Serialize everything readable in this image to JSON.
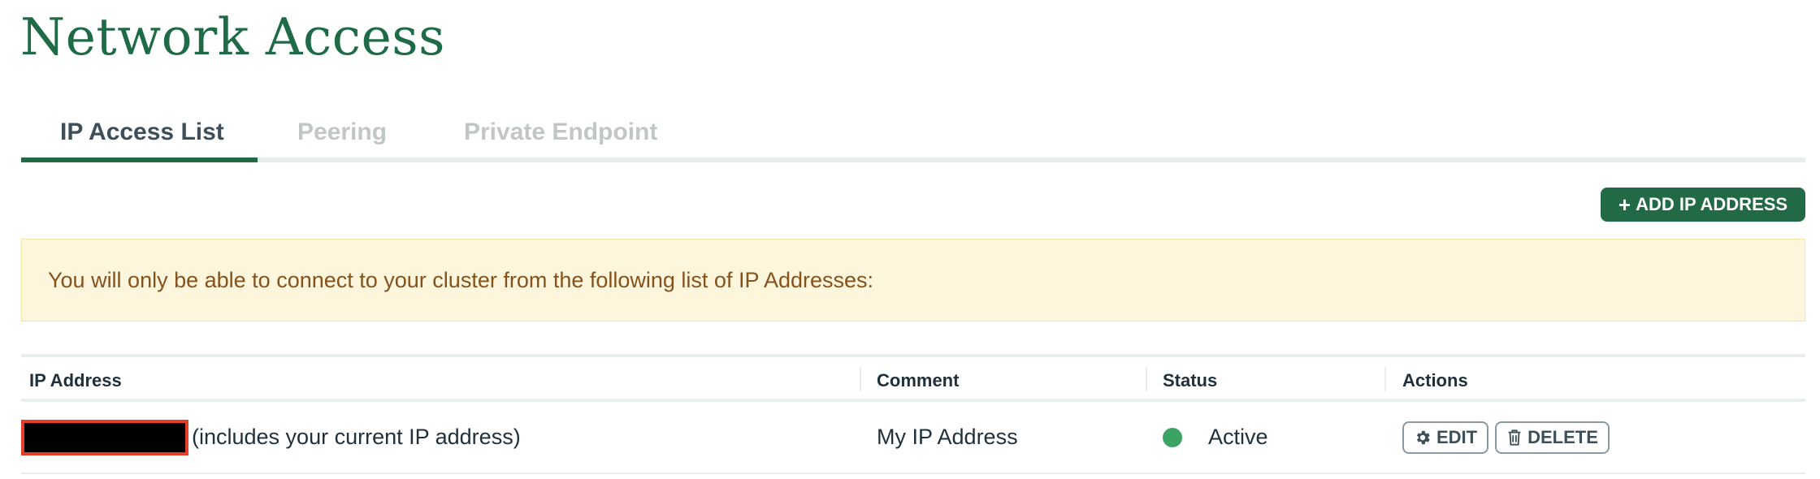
{
  "page": {
    "title": "Network Access"
  },
  "tabs": [
    {
      "label": "IP Access List",
      "active": true
    },
    {
      "label": "Peering",
      "active": false
    },
    {
      "label": "Private Endpoint",
      "active": false
    }
  ],
  "toolbar": {
    "add_label": "ADD IP ADDRESS",
    "add_icon": "plus-icon"
  },
  "banner": {
    "message": "You will only be able to connect to your cluster from the following list of IP Addresses:"
  },
  "table": {
    "headers": {
      "ip": "IP Address",
      "comment": "Comment",
      "status": "Status",
      "actions": "Actions"
    },
    "rows": [
      {
        "ip_note": "(includes your current IP address)",
        "comment": "My IP Address",
        "status": "Active",
        "status_color": "#3ba363",
        "edit_label": "EDIT",
        "edit_icon": "gear-icon",
        "delete_label": "DELETE",
        "delete_icon": "trash-icon"
      }
    ]
  },
  "colors": {
    "brand": "#216a45",
    "title": "#1f6b47",
    "banner_bg": "#fdf6dd",
    "banner_text": "#86521b",
    "redaction_border": "#e2402a"
  }
}
